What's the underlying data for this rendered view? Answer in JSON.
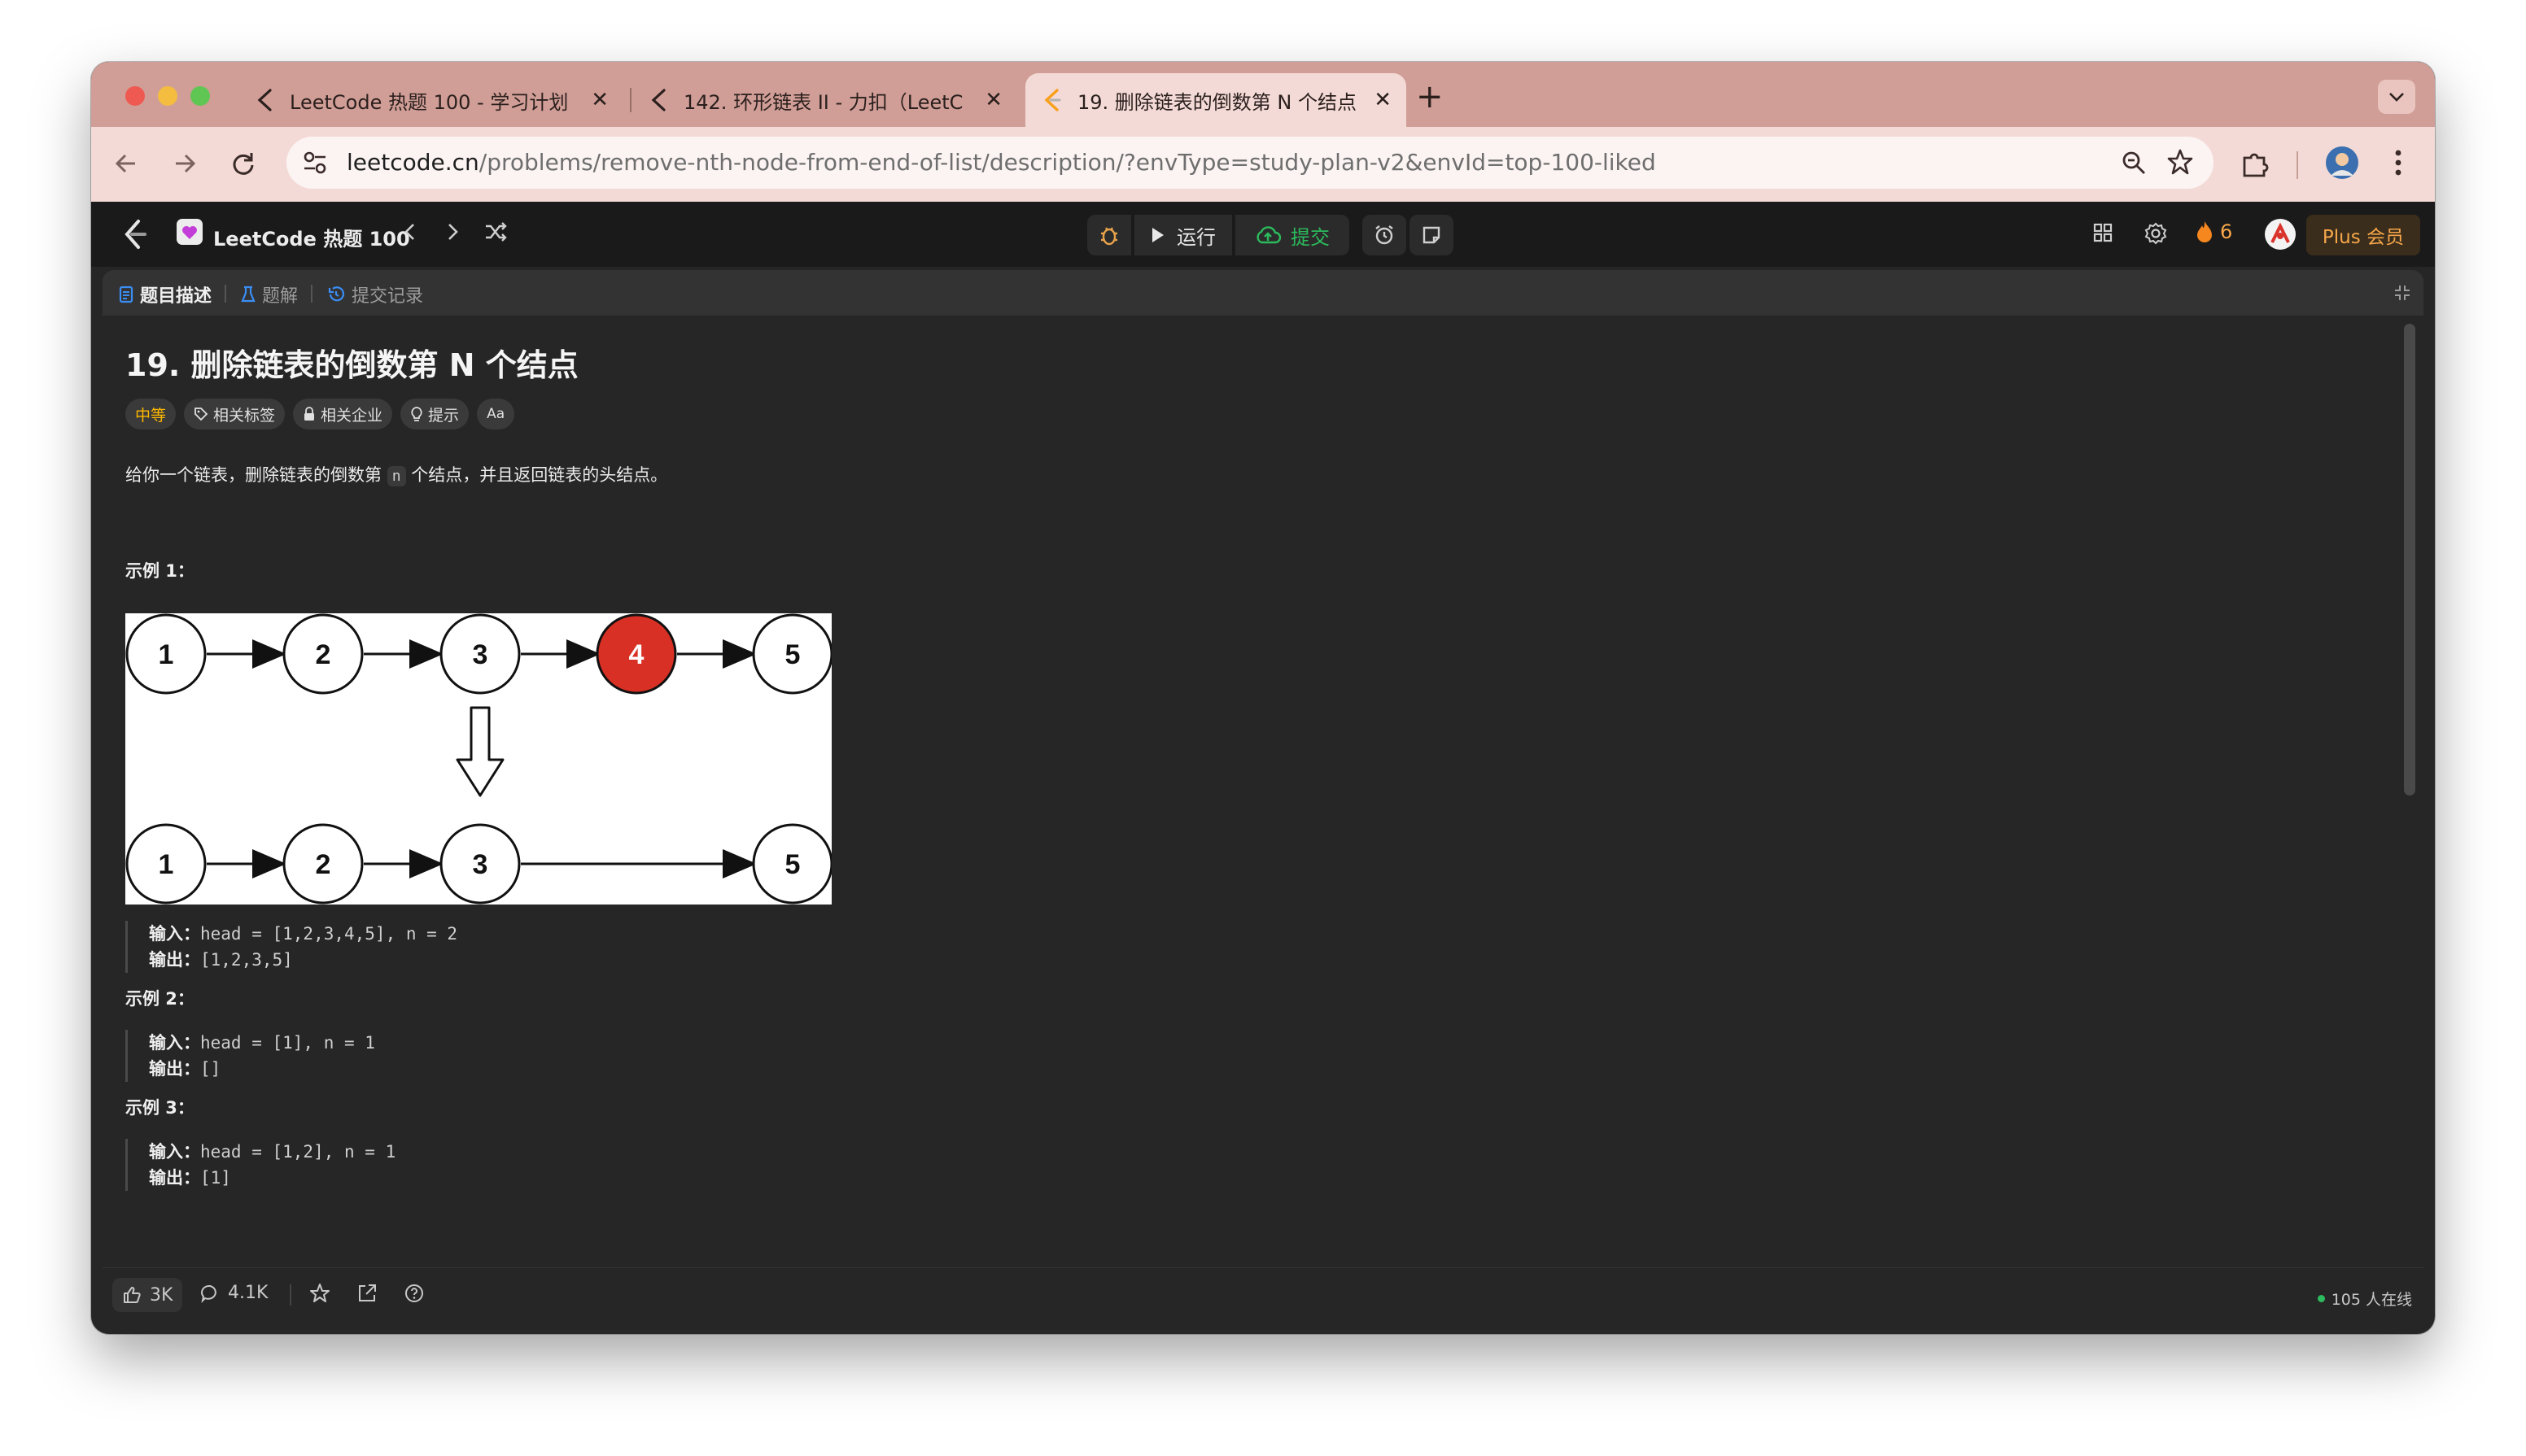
{
  "browser": {
    "tabs": [
      {
        "title": "LeetCode 热题 100 - 学习计划",
        "active": false
      },
      {
        "title": "142. 环形链表 II - 力扣（LeetC",
        "active": false
      },
      {
        "title": "19. 删除链表的倒数第 N 个结点",
        "active": true
      }
    ],
    "url_host": "leetcode.cn",
    "url_path": "/problems/remove-nth-node-from-end-of-list/description/?envType=study-plan-v2&envId=top-100-liked"
  },
  "header": {
    "study_plan_title": "LeetCode 热题 100",
    "run_label": "运行",
    "submit_label": "提交",
    "streak_count": "6",
    "plus_label": "Plus 会员"
  },
  "panel_tabs": {
    "description": "题目描述",
    "solutions": "题解",
    "submissions": "提交记录"
  },
  "problem": {
    "title": "19. 删除链表的倒数第 N 个结点",
    "difficulty": "中等",
    "tags": [
      "相关标签",
      "相关企业",
      "提示",
      "Aa"
    ],
    "desc_before": "给你一个链表，删除链表的倒数第 ",
    "desc_code": "n",
    "desc_after": " 个结点，并且返回链表的头结点。",
    "figure": {
      "top_nodes": [
        "1",
        "2",
        "3",
        "4",
        "5"
      ],
      "bottom_nodes": [
        "1",
        "2",
        "3",
        "5"
      ],
      "highlight_node": "4"
    },
    "examples": [
      {
        "heading": "示例 1：",
        "input_label": "输入：",
        "input": "head = [1,2,3,4,5], n = 2",
        "output_label": "输出：",
        "output": "[1,2,3,5]"
      },
      {
        "heading": "示例 2：",
        "input_label": "输入：",
        "input": "head = [1], n = 1",
        "output_label": "输出：",
        "output": "[]"
      },
      {
        "heading": "示例 3：",
        "input_label": "输入：",
        "input": "head = [1,2], n = 1",
        "output_label": "输出：",
        "output": "[1]"
      }
    ]
  },
  "footer": {
    "likes": "3K",
    "comments": "4.1K",
    "online": "105 人在线"
  },
  "colors": {
    "accent_orange": "#f6a74a",
    "difficulty_medium": "#ffb800",
    "node_highlight": "#d93025",
    "online_green": "#2cbb5d"
  }
}
